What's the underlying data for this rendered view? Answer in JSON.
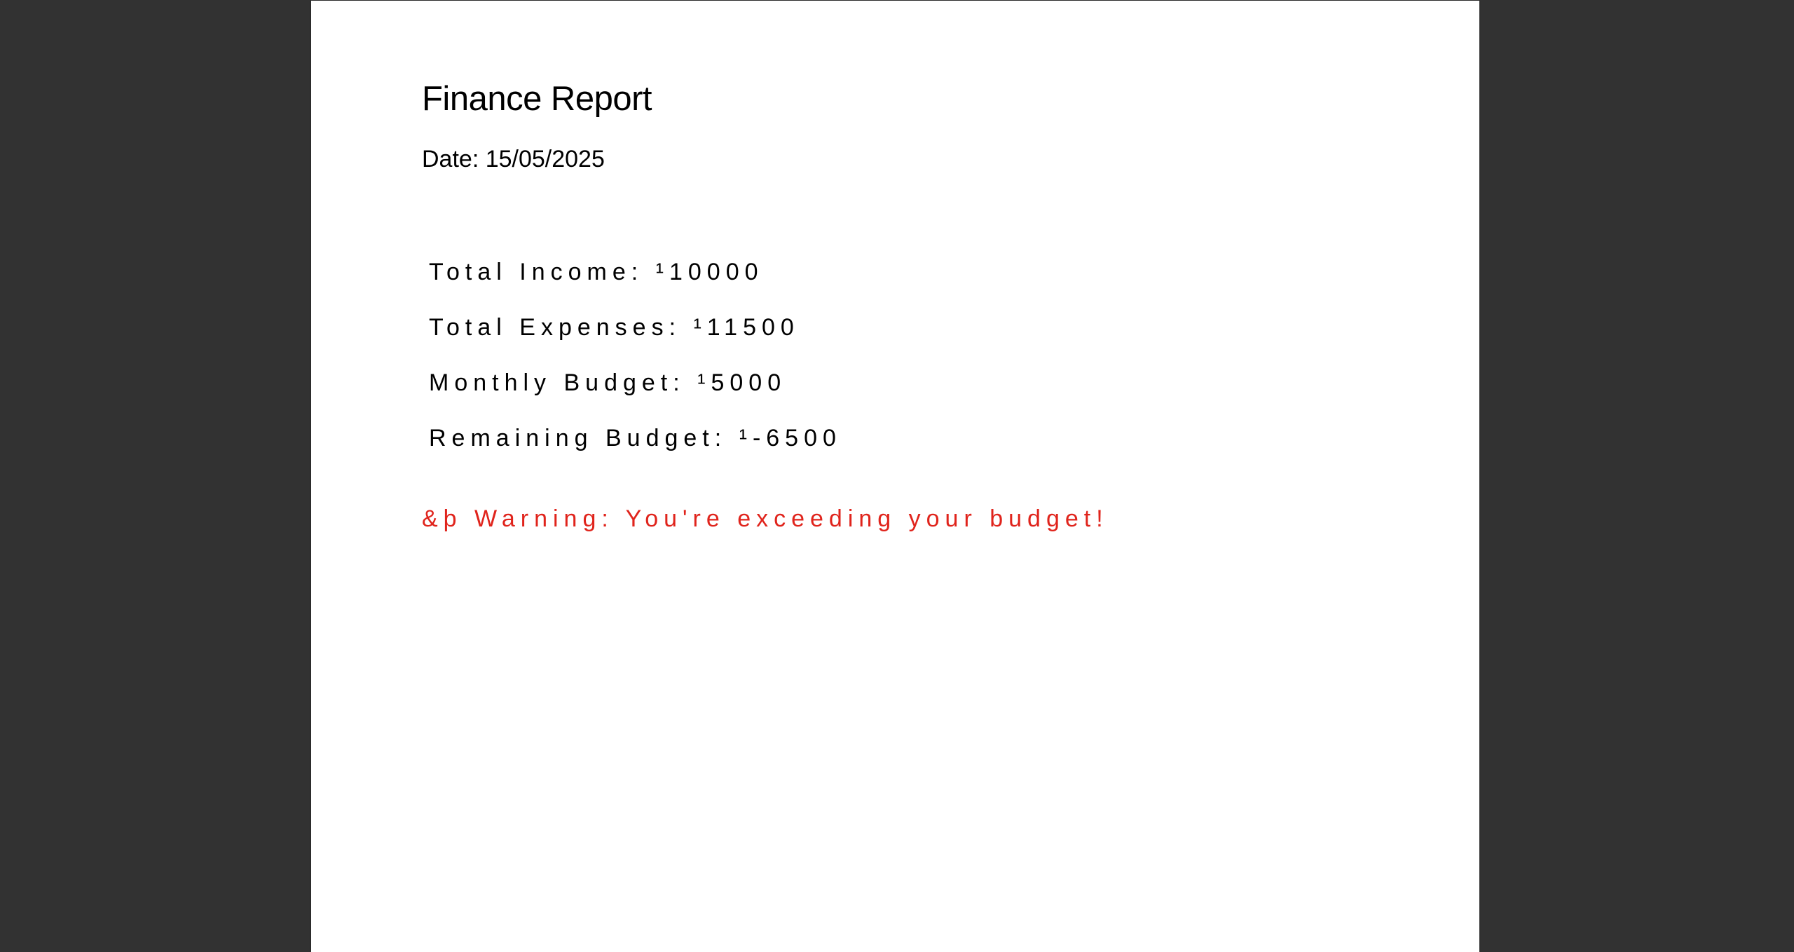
{
  "colors": {
    "viewer_background": "#323232",
    "page_background": "#ffffff",
    "text": "#000000",
    "warning": "#e0241c"
  },
  "report": {
    "title": "Finance Report",
    "date": "Date: 15/05/2025",
    "summary": [
      "Total Income: ¹10000",
      "Total Expenses: ¹11500",
      "Monthly Budget: ¹5000",
      "Remaining Budget: ¹-6500"
    ],
    "warning": "&þ  Warning: You're exceeding your budget!"
  }
}
